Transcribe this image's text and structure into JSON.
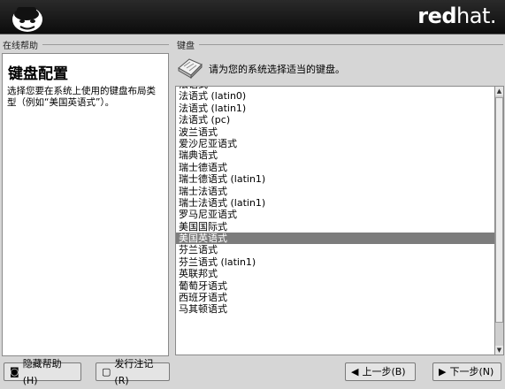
{
  "brand": {
    "bold": "red",
    "light": "hat."
  },
  "help": {
    "group_label": "在线帮助",
    "title": "键盘配置",
    "body": "选择您要在系统上使用的键盘布局类型（例如“美国英语式”）。"
  },
  "keyboard": {
    "group_label": "键盘",
    "instruction": "请为您的系统选择适当的键盘。",
    "selected": "美国英语式",
    "items": [
      "法语式",
      "法语式 (latin0)",
      "法语式 (latin1)",
      "法语式 (pc)",
      "波兰语式",
      "爱沙尼亚语式",
      "瑞典语式",
      "瑞士德语式",
      "瑞士德语式 (latin1)",
      "瑞士法语式",
      "瑞士法语式 (latin1)",
      "罗马尼亚语式",
      "美国国际式",
      "美国英语式",
      "芬兰语式",
      "芬兰语式 (latin1)",
      "英联邦式",
      "葡萄牙语式",
      "西班牙语式",
      "马其顿语式"
    ]
  },
  "buttons": {
    "hide_help": "隐藏帮助(H)",
    "release_notes": "发行注记(R)",
    "back": "上一步(B)",
    "next": "下一步(N)"
  }
}
